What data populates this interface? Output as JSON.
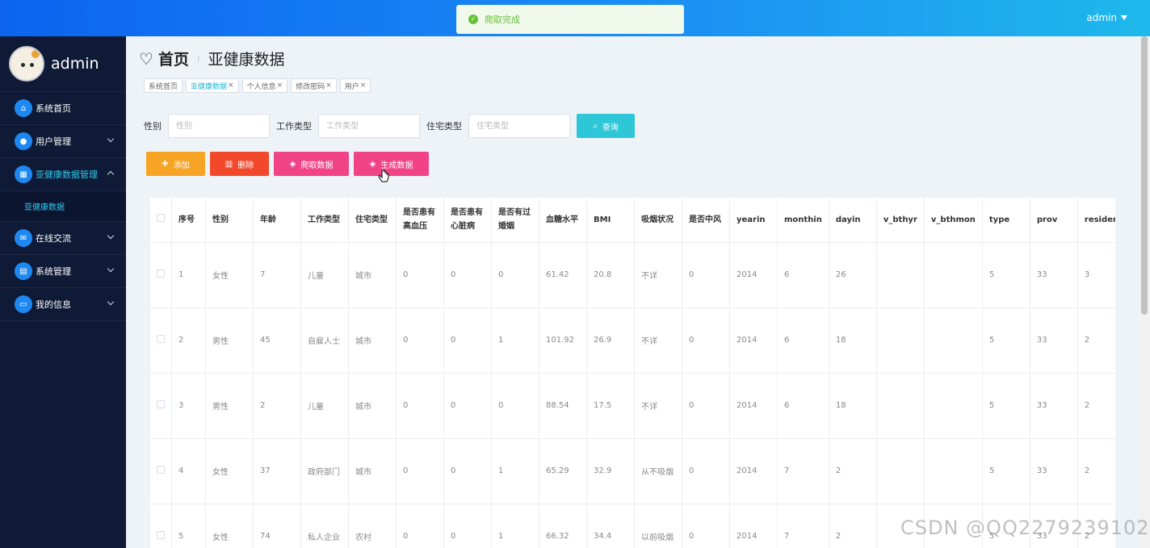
{
  "topbar": {
    "user": "admin"
  },
  "toast": {
    "text": "爬取完成"
  },
  "sidebar": {
    "brand": "admin",
    "items": [
      {
        "label": "系统首页",
        "icon": "home-icon",
        "has_children": false
      },
      {
        "label": "用户管理",
        "icon": "user-icon",
        "has_children": true
      },
      {
        "label": "亚健康数据管理",
        "icon": "grid-icon",
        "has_children": true,
        "expanded": true
      },
      {
        "label": "在线交流",
        "icon": "chat-icon",
        "has_children": true
      },
      {
        "label": "系统管理",
        "icon": "table-icon",
        "has_children": true
      },
      {
        "label": "我的信息",
        "icon": "card-icon",
        "has_children": true
      }
    ],
    "sub_item": "亚健康数据"
  },
  "header": {
    "home": "首页",
    "page": "亚健康数据"
  },
  "tags": [
    {
      "label": "系统首页",
      "closable": false
    },
    {
      "label": "亚健康数据",
      "closable": true,
      "active": true
    },
    {
      "label": "个人信息",
      "closable": true
    },
    {
      "label": "修改密码",
      "closable": true
    },
    {
      "label": "用户",
      "closable": true
    }
  ],
  "search": {
    "gender_label": "性别",
    "gender_placeholder": "性别",
    "work_label": "工作类型",
    "work_placeholder": "工作类型",
    "residence_label": "住宅类型",
    "residence_placeholder": "住宅类型",
    "query_button": "查询"
  },
  "actions": {
    "add": "添加",
    "delete": "删除",
    "crawl": "爬取数据",
    "generate": "生成数据"
  },
  "table": {
    "columns": [
      "序号",
      "性别",
      "年龄",
      "工作类型",
      "住宅类型",
      "是否患有高血压",
      "是否患有心脏病",
      "是否有过婚姻",
      "血糖水平",
      "BMI",
      "吸烟状况",
      "是否中风",
      "yearin",
      "monthin",
      "dayin",
      "v_bthyr",
      "v_bthmon",
      "type",
      "prov",
      "residenc"
    ],
    "rows": [
      [
        "1",
        "女性",
        "7",
        "儿童",
        "城市",
        "0",
        "0",
        "0",
        "61.42",
        "20.8",
        "不详",
        "0",
        "2014",
        "6",
        "26",
        "",
        "",
        "5",
        "33",
        "3"
      ],
      [
        "2",
        "男性",
        "45",
        "自雇人士",
        "城市",
        "0",
        "0",
        "1",
        "101.92",
        "26.9",
        "不详",
        "0",
        "2014",
        "6",
        "18",
        "",
        "",
        "5",
        "33",
        "2"
      ],
      [
        "3",
        "男性",
        "2",
        "儿童",
        "城市",
        "0",
        "0",
        "0",
        "88.54",
        "17.5",
        "不详",
        "0",
        "2014",
        "6",
        "18",
        "",
        "",
        "5",
        "33",
        "2"
      ],
      [
        "4",
        "女性",
        "37",
        "政府部门",
        "城市",
        "0",
        "0",
        "1",
        "65.29",
        "32.9",
        "从不吸烟",
        "0",
        "2014",
        "7",
        "2",
        "",
        "",
        "5",
        "33",
        "2"
      ],
      [
        "5",
        "女性",
        "74",
        "私人企业",
        "农村",
        "0",
        "0",
        "1",
        "66.32",
        "34.4",
        "以前吸烟",
        "0",
        "2014",
        "7",
        "2",
        "",
        "",
        "5",
        "33",
        "2"
      ]
    ]
  },
  "watermark": "CSDN @QQ2279239102"
}
